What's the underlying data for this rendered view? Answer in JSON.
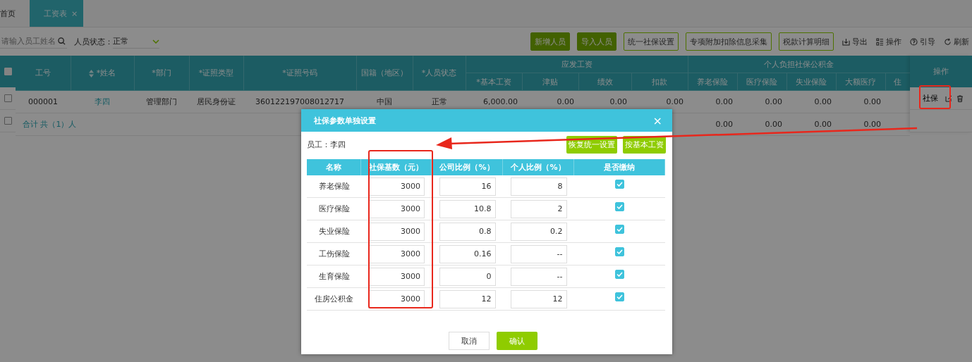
{
  "tabs": [
    {
      "label": "首页",
      "selected": false,
      "closable": false
    },
    {
      "label": "工资表",
      "selected": true,
      "closable": true
    }
  ],
  "close_tab_glyph": "×",
  "toolbar": {
    "search": {
      "placeholder": "请输入员工姓名"
    },
    "status_filter": {
      "label": "人员状态：",
      "value": "正常"
    },
    "buttons": [
      {
        "label": "新增人员",
        "kind": "solid"
      },
      {
        "label": "导入人员",
        "kind": "solid"
      },
      {
        "label": "统一社保设置",
        "kind": "outline"
      },
      {
        "label": "专项附加扣除信息采集",
        "kind": "outline"
      },
      {
        "label": "税款计算明细",
        "kind": "outline"
      }
    ],
    "actions": [
      {
        "label": "导出",
        "kind": "export"
      },
      {
        "label": "操作",
        "kind": "columns"
      },
      {
        "label": "引导",
        "kind": "help"
      },
      {
        "label": "刷新",
        "kind": "refresh"
      }
    ]
  },
  "table": {
    "select_all_checked": false,
    "columns": [
      {
        "label": "工号",
        "sortable": false
      },
      {
        "label": "*姓名",
        "sortable": true
      },
      {
        "label": "*部门",
        "sortable": false
      },
      {
        "label": "*证照类型",
        "sortable": false
      },
      {
        "label": "*证照号码",
        "sortable": false
      },
      {
        "label": "国籍（地区）",
        "sortable": false
      },
      {
        "label": "*人员状态",
        "sortable": false
      }
    ],
    "groups": [
      {
        "label": "应发工资",
        "columns": [
          "*基本工资",
          "津贴",
          "绩效",
          "扣款"
        ]
      },
      {
        "label": "个人负担社保公积金",
        "columns": [
          "养老保险",
          "医疗保险",
          "失业保险",
          "大额医疗",
          "住"
        ]
      }
    ],
    "action_column": "操作",
    "rows": [
      {
        "kind": "employee",
        "checked": false,
        "cells": [
          "000001",
          "李四",
          "管理部门",
          "居民身份证",
          "360122197008012717",
          "中国",
          "正常",
          "6,000.00",
          "0.00",
          "0.00",
          "0.00",
          "0.00",
          "0.00",
          "0.00",
          "0.00",
          ""
        ],
        "action": "社保"
      },
      {
        "kind": "total",
        "checked": false,
        "label": "合计 共（1）人",
        "cells": [
          "",
          "",
          "",
          "",
          "",
          "",
          "",
          "",
          "",
          "",
          "",
          "0.00",
          "0.00",
          "0.00",
          "0.00",
          ""
        ]
      }
    ]
  },
  "dialog": {
    "title": "社保参数单独设置",
    "close": "×",
    "employee": "员工：李四",
    "buttons": [
      "恢复统一设置",
      "按基本工资"
    ],
    "columns": [
      "名称",
      "社保基数（元）",
      "公司比例（%）",
      "个人比例（%）",
      "是否缴纳"
    ],
    "rows": [
      {
        "name": "养老保险",
        "base": "3000",
        "company": "16",
        "personal": "8",
        "paid": true
      },
      {
        "name": "医疗保险",
        "base": "3000",
        "company": "10.8",
        "personal": "2",
        "paid": true
      },
      {
        "name": "失业保险",
        "base": "3000",
        "company": "0.8",
        "personal": "0.2",
        "paid": true
      },
      {
        "name": "工伤保险",
        "base": "3000",
        "company": "0.16",
        "personal": "--",
        "paid": true
      },
      {
        "name": "生育保险",
        "base": "3000",
        "company": "0",
        "personal": "--",
        "paid": true
      },
      {
        "name": "住房公积金",
        "base": "3000",
        "company": "12",
        "personal": "12",
        "paid": true
      }
    ],
    "cancel": "取消",
    "confirm": "确认"
  }
}
